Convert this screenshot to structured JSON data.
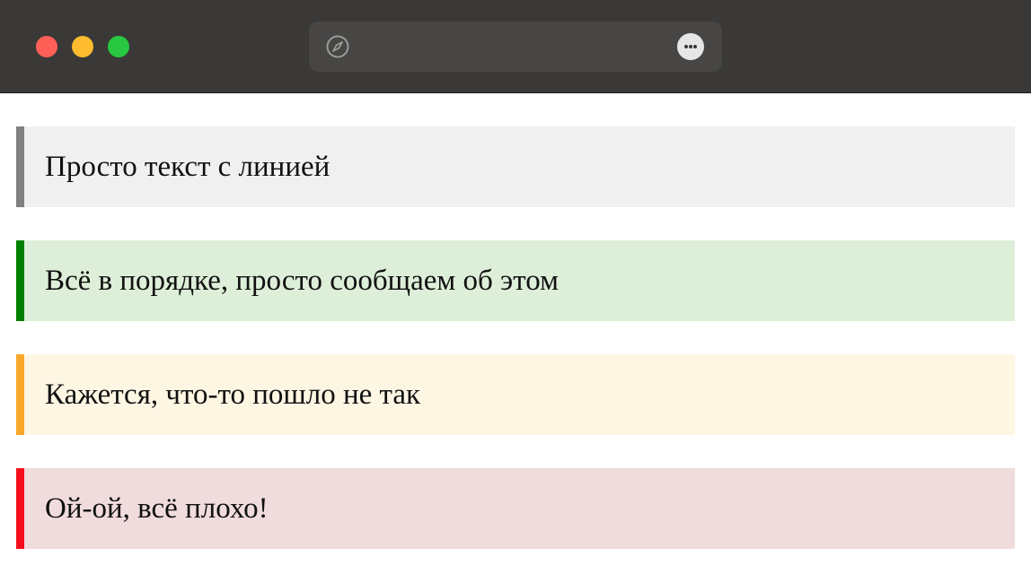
{
  "browser": {
    "traffic_lights": {
      "close_color": "#fe5f57",
      "minimize_color": "#febc2e",
      "maximize_color": "#28c840"
    },
    "address_bar": {
      "left_icon": "compass-icon",
      "right_icon": "more-options-icon"
    }
  },
  "callouts": [
    {
      "text": "Просто текст с линией",
      "border_color": "#808080",
      "background": "#f0f0f0"
    },
    {
      "text": "Всё в порядке, просто сообщаем об этом",
      "border_color": "#008000",
      "background": "#ddefd8"
    },
    {
      "text": "Кажется, что-то пошло не так",
      "border_color": "#f9a72b",
      "background": "#fdf6e3"
    },
    {
      "text": "Ой-ой, всё плохо!",
      "border_color": "#f50f1d",
      "background": "#f0dcdc"
    }
  ]
}
